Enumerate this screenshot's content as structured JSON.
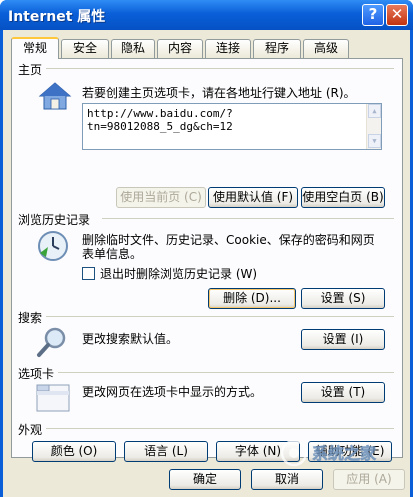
{
  "window": {
    "title": "Internet 属性",
    "help_glyph": "?",
    "close_glyph": "✕"
  },
  "tabs": [
    {
      "label": "常规",
      "active": true
    },
    {
      "label": "安全"
    },
    {
      "label": "隐私"
    },
    {
      "label": "内容"
    },
    {
      "label": "连接"
    },
    {
      "label": "程序"
    },
    {
      "label": "高级"
    }
  ],
  "home": {
    "section": "主页",
    "desc": "若要创建主页选项卡，请在各地址行键入地址 (R)。",
    "url": "http://www.baidu.com/?tn=98012088_5_dg&ch=12",
    "use_current": "使用当前页 (C)",
    "use_default": "使用默认值 (F)",
    "use_blank": "使用空白页 (B)"
  },
  "history": {
    "section": "浏览历史记录",
    "desc_line1": "删除临时文件、历史记录、Cookie、保存的密码和网页",
    "desc_line2": "表单信息。",
    "checkbox_label": "退出时删除浏览历史记录 (W)",
    "delete": "删除 (D)...",
    "settings": "设置 (S)"
  },
  "search": {
    "section": "搜索",
    "desc": "更改搜索默认值。",
    "settings": "设置 (I)"
  },
  "tabs_section": {
    "section": "选项卡",
    "desc": "更改网页在选项卡中显示的方式。",
    "settings": "设置 (T)"
  },
  "appearance": {
    "section": "外观",
    "colors": "颜色 (O)",
    "languages": "语言 (L)",
    "fonts": "字体 (N)",
    "accessibility": "辅助功能 (E)"
  },
  "footer": {
    "ok": "确定",
    "cancel": "取消",
    "apply": "应用 (A)"
  },
  "watermark": {
    "text": "系统之家"
  },
  "colors": {
    "title_blue": "#0a5fd8",
    "dialog_bg": "#ece9d8",
    "panel_bg": "#fcfcfe",
    "button_border": "#003c74"
  }
}
